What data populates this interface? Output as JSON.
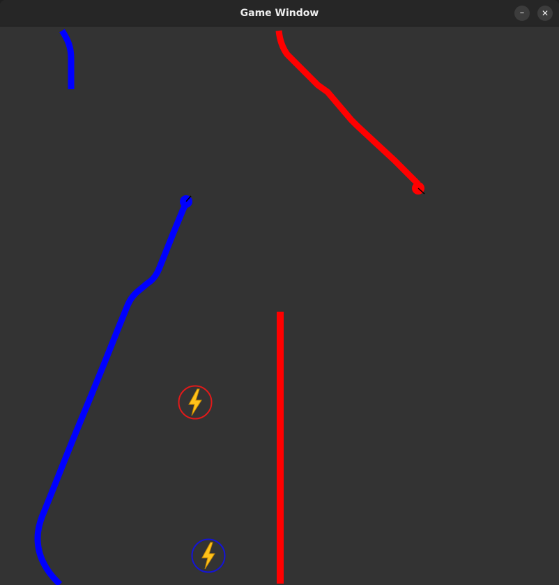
{
  "window": {
    "title": "Game Window",
    "minimize_symbol": "–",
    "close_symbol": "✕",
    "background": "#333333",
    "titlebar_background": "#262626"
  },
  "players": [
    {
      "name": "blue",
      "color": "#0000ff"
    },
    {
      "name": "red",
      "color": "#ff0000"
    }
  ],
  "powerups": [
    {
      "type": "lightning",
      "icon": "lightning-bolt-icon",
      "ring_color": "#e11a1a"
    },
    {
      "type": "lightning",
      "icon": "lightning-bolt-icon",
      "ring_color": "#1414d8"
    }
  ]
}
